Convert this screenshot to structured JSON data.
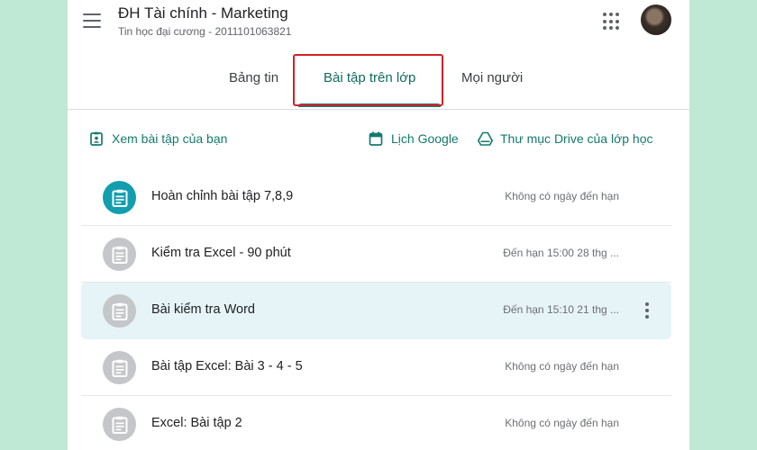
{
  "header": {
    "class_name": "ĐH Tài chính - Marketing",
    "class_subtitle": "Tin học đại cương - 2011101063821"
  },
  "tabs": [
    {
      "label": "Bảng tin"
    },
    {
      "label": "Bài tập trên lớp"
    },
    {
      "label": "Mọi người"
    }
  ],
  "actions": {
    "view_work": "Xem bài tập của bạn",
    "calendar": "Lịch Google",
    "drive_folder": "Thư mục Drive của lớp học"
  },
  "assignments": [
    {
      "title": "Hoàn chỉnh bài tập 7,8,9",
      "due": "Không có ngày đến hạn",
      "icon": "assignment-icon",
      "color": "#129eaf"
    },
    {
      "title": "Kiểm tra Excel - 90 phút",
      "due": "Đến hạn 15:00 28 thg ...",
      "icon": "assignment-icon",
      "color": "#c4c6c9"
    },
    {
      "title": "Bài kiểm tra Word",
      "due": "Đến hạn 15:10 21 thg ...",
      "icon": "assignment-icon",
      "color": "#c4c6c9",
      "selected": true
    },
    {
      "title": "Bài tập Excel: Bài 3 - 4 - 5",
      "due": "Không có ngày đến hạn",
      "icon": "assignment-icon",
      "color": "#c4c6c9"
    },
    {
      "title": "Excel: Bài tập 2",
      "due": "Không có ngày đến hạn",
      "icon": "assignment-icon",
      "color": "#c4c6c9"
    }
  ],
  "colors": {
    "accent": "#188072",
    "highlight": "#d32027",
    "background": "#bfe8d5"
  }
}
